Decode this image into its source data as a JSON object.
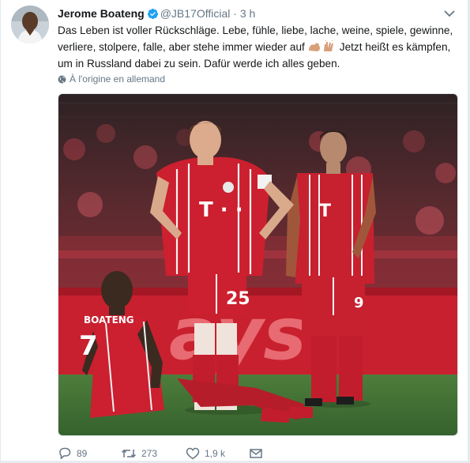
{
  "tweet": {
    "display_name": "Jerome Boateng",
    "handle": "@JB17Official",
    "separator": "·",
    "time": "3 h",
    "text_before_emoji": "Das Leben ist voller Rückschläge. Lebe, fühle, liebe, lache, weine, spiele, gewinne, verliere, stolpere, falle, aber stehe immer wieder auf",
    "text_after_emoji": "Jetzt heißt es kämpfen, um in Russland dabei zu sein. Dafür werde ich alles geben.",
    "emoji": "💪🏽🙌🏽",
    "translate_label": "À l'origine en allemand",
    "photo_text": {
      "player1_name": "BOATENG",
      "player1_number": "7",
      "player2_number": "25",
      "player3_number": "9",
      "banner_text": "ays"
    }
  },
  "actions": {
    "reply_count": "89",
    "retweet_count": "273",
    "like_count": "1,9 k"
  },
  "colors": {
    "verified": "#1da1f2",
    "secondary_text": "#657786",
    "bayern_red": "#cc1f2f",
    "pitch_green": "#3f6f34"
  },
  "icons": {
    "verified": "verified-badge-icon",
    "caret": "chevron-down-icon",
    "globe": "globe-icon",
    "reply": "reply-icon",
    "retweet": "retweet-icon",
    "like": "heart-icon",
    "dm": "envelope-icon"
  }
}
